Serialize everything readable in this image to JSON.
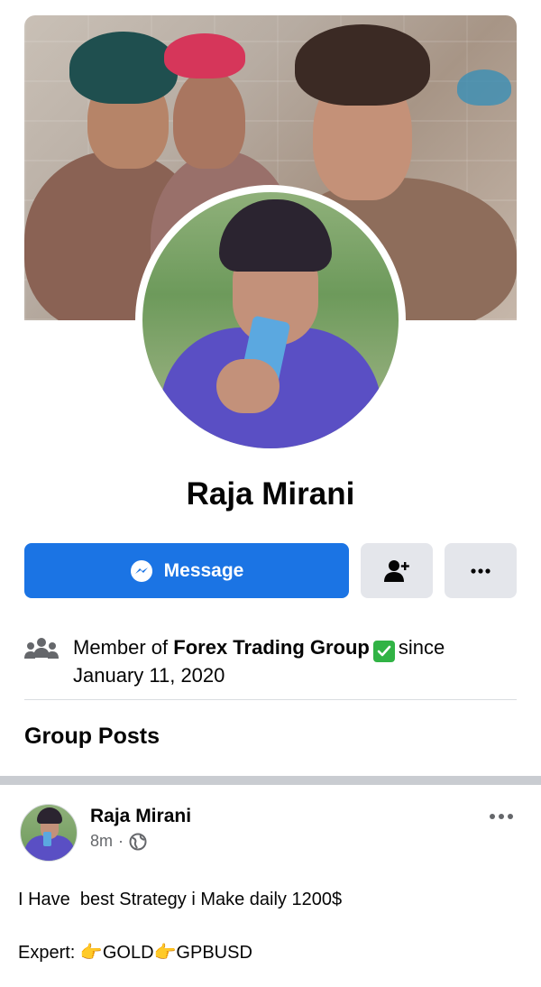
{
  "profile": {
    "name": "Raja Mirani"
  },
  "actions": {
    "message_label": "Message"
  },
  "membership": {
    "prefix": "Member of",
    "group_name": "Forex Trading Group",
    "suffix": "since",
    "date": "January 11, 2020"
  },
  "section": {
    "title": "Group Posts"
  },
  "post": {
    "author": "Raja Mirani",
    "time": "8m",
    "separator": "·",
    "line1": "I Have  best Strategy i Make daily 1200$",
    "line2_prefix": "Expert:",
    "line2_item1": "GOLD",
    "line2_item2": "GPBUSD"
  },
  "icons": {
    "message": "messenger-icon",
    "add_friend": "add-friend-icon",
    "more": "more-dots-icon",
    "group": "group-members-icon",
    "verified": "check-mark-icon",
    "privacy": "globe-icon",
    "pointing": "pointing-hand-emoji"
  },
  "colors": {
    "primary": "#1b74e4",
    "button_gray": "#e4e6eb",
    "check_green": "#31b345",
    "secondary_text": "#65676b"
  }
}
